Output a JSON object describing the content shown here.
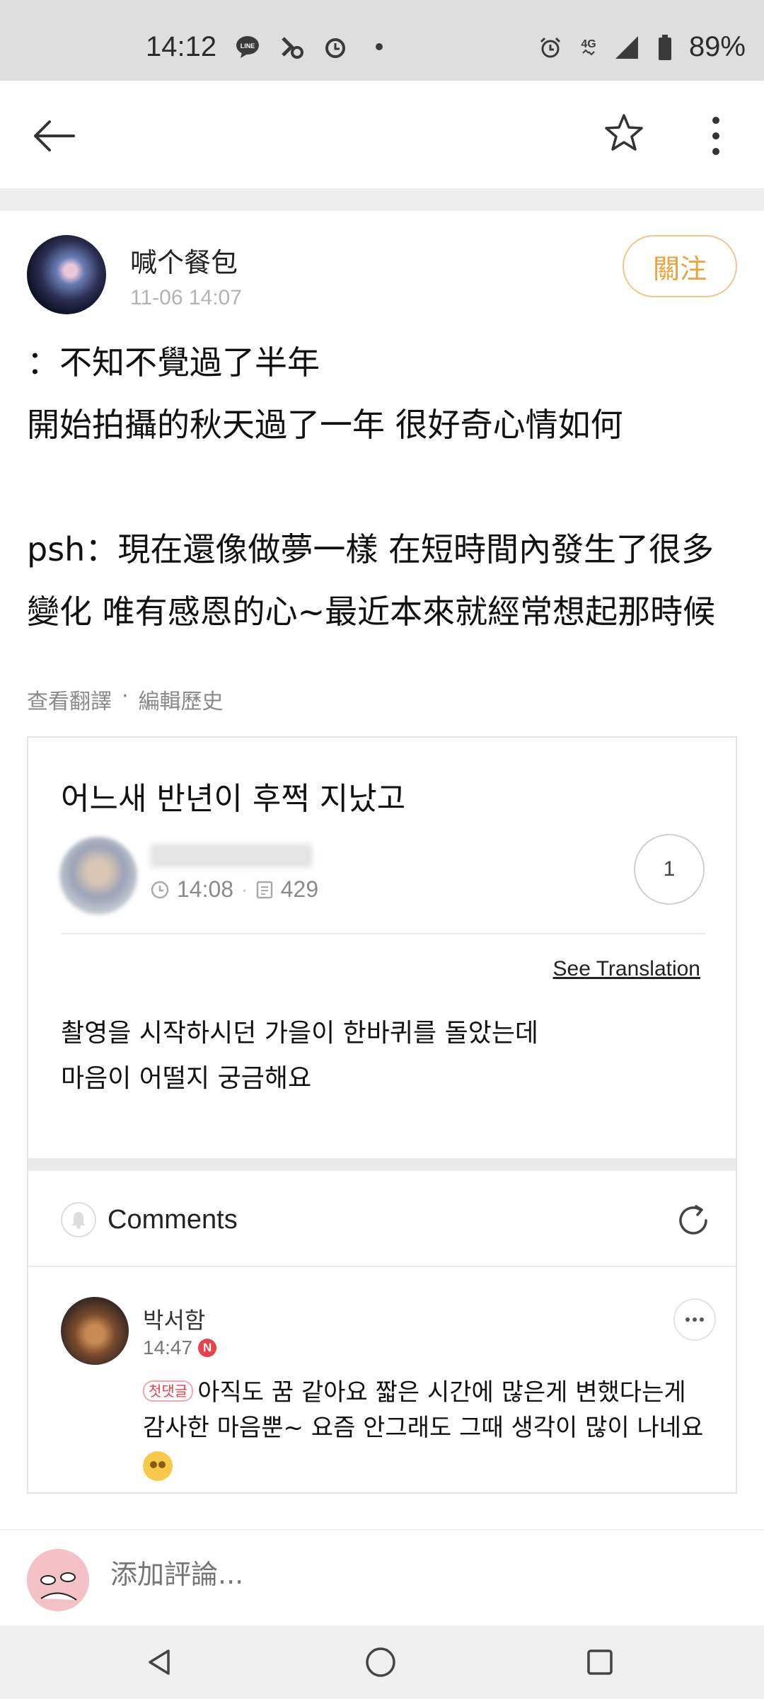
{
  "status_bar": {
    "time": "14:12",
    "network": "4G",
    "battery": "89%"
  },
  "app_bar": {
    "icons": [
      "back-arrow-icon",
      "star-icon",
      "more-vertical-icon"
    ]
  },
  "post": {
    "author": "喊个餐包",
    "timestamp": "11-06 14:07",
    "follow_label": "關注",
    "body_lines": [
      "：不知不覺過了半年",
      "開始拍攝的秋天過了一年 很好奇心情如何",
      "",
      "psh：現在還像做夢一樣 在短時間內發生了很多變化 唯有感恩的心~最近本來就經常想起那時候"
    ],
    "link_translate": "查看翻譯",
    "link_separator": "·",
    "link_history": "編輯歷史"
  },
  "card": {
    "title": "어느새 반년이 후쩍 지났고",
    "time": "14:08",
    "views": "429",
    "comment_count": "1",
    "see_translation": "See Translation",
    "body_line1": "촬영을 시작하시던 가을이 한바퀴를 돌았는데",
    "body_line2": "마음이 어떨지 궁금해요",
    "comments_label": "Comments",
    "comment": {
      "user": "박서함",
      "time": "14:47",
      "new_badge": "N",
      "first_badge": "첫댓글",
      "text": "아직도 꿈 같아요 짧은 시간에 많은게 변했다는게 감사한 마음뿐~ 요즘 안그래도 그때 생각이 많이 나네요"
    }
  },
  "input": {
    "placeholder": "添加評論..."
  },
  "colors": {
    "accent": "#e9a33c",
    "follow_border": "#f3c38a",
    "new_badge": "#e8424b"
  }
}
